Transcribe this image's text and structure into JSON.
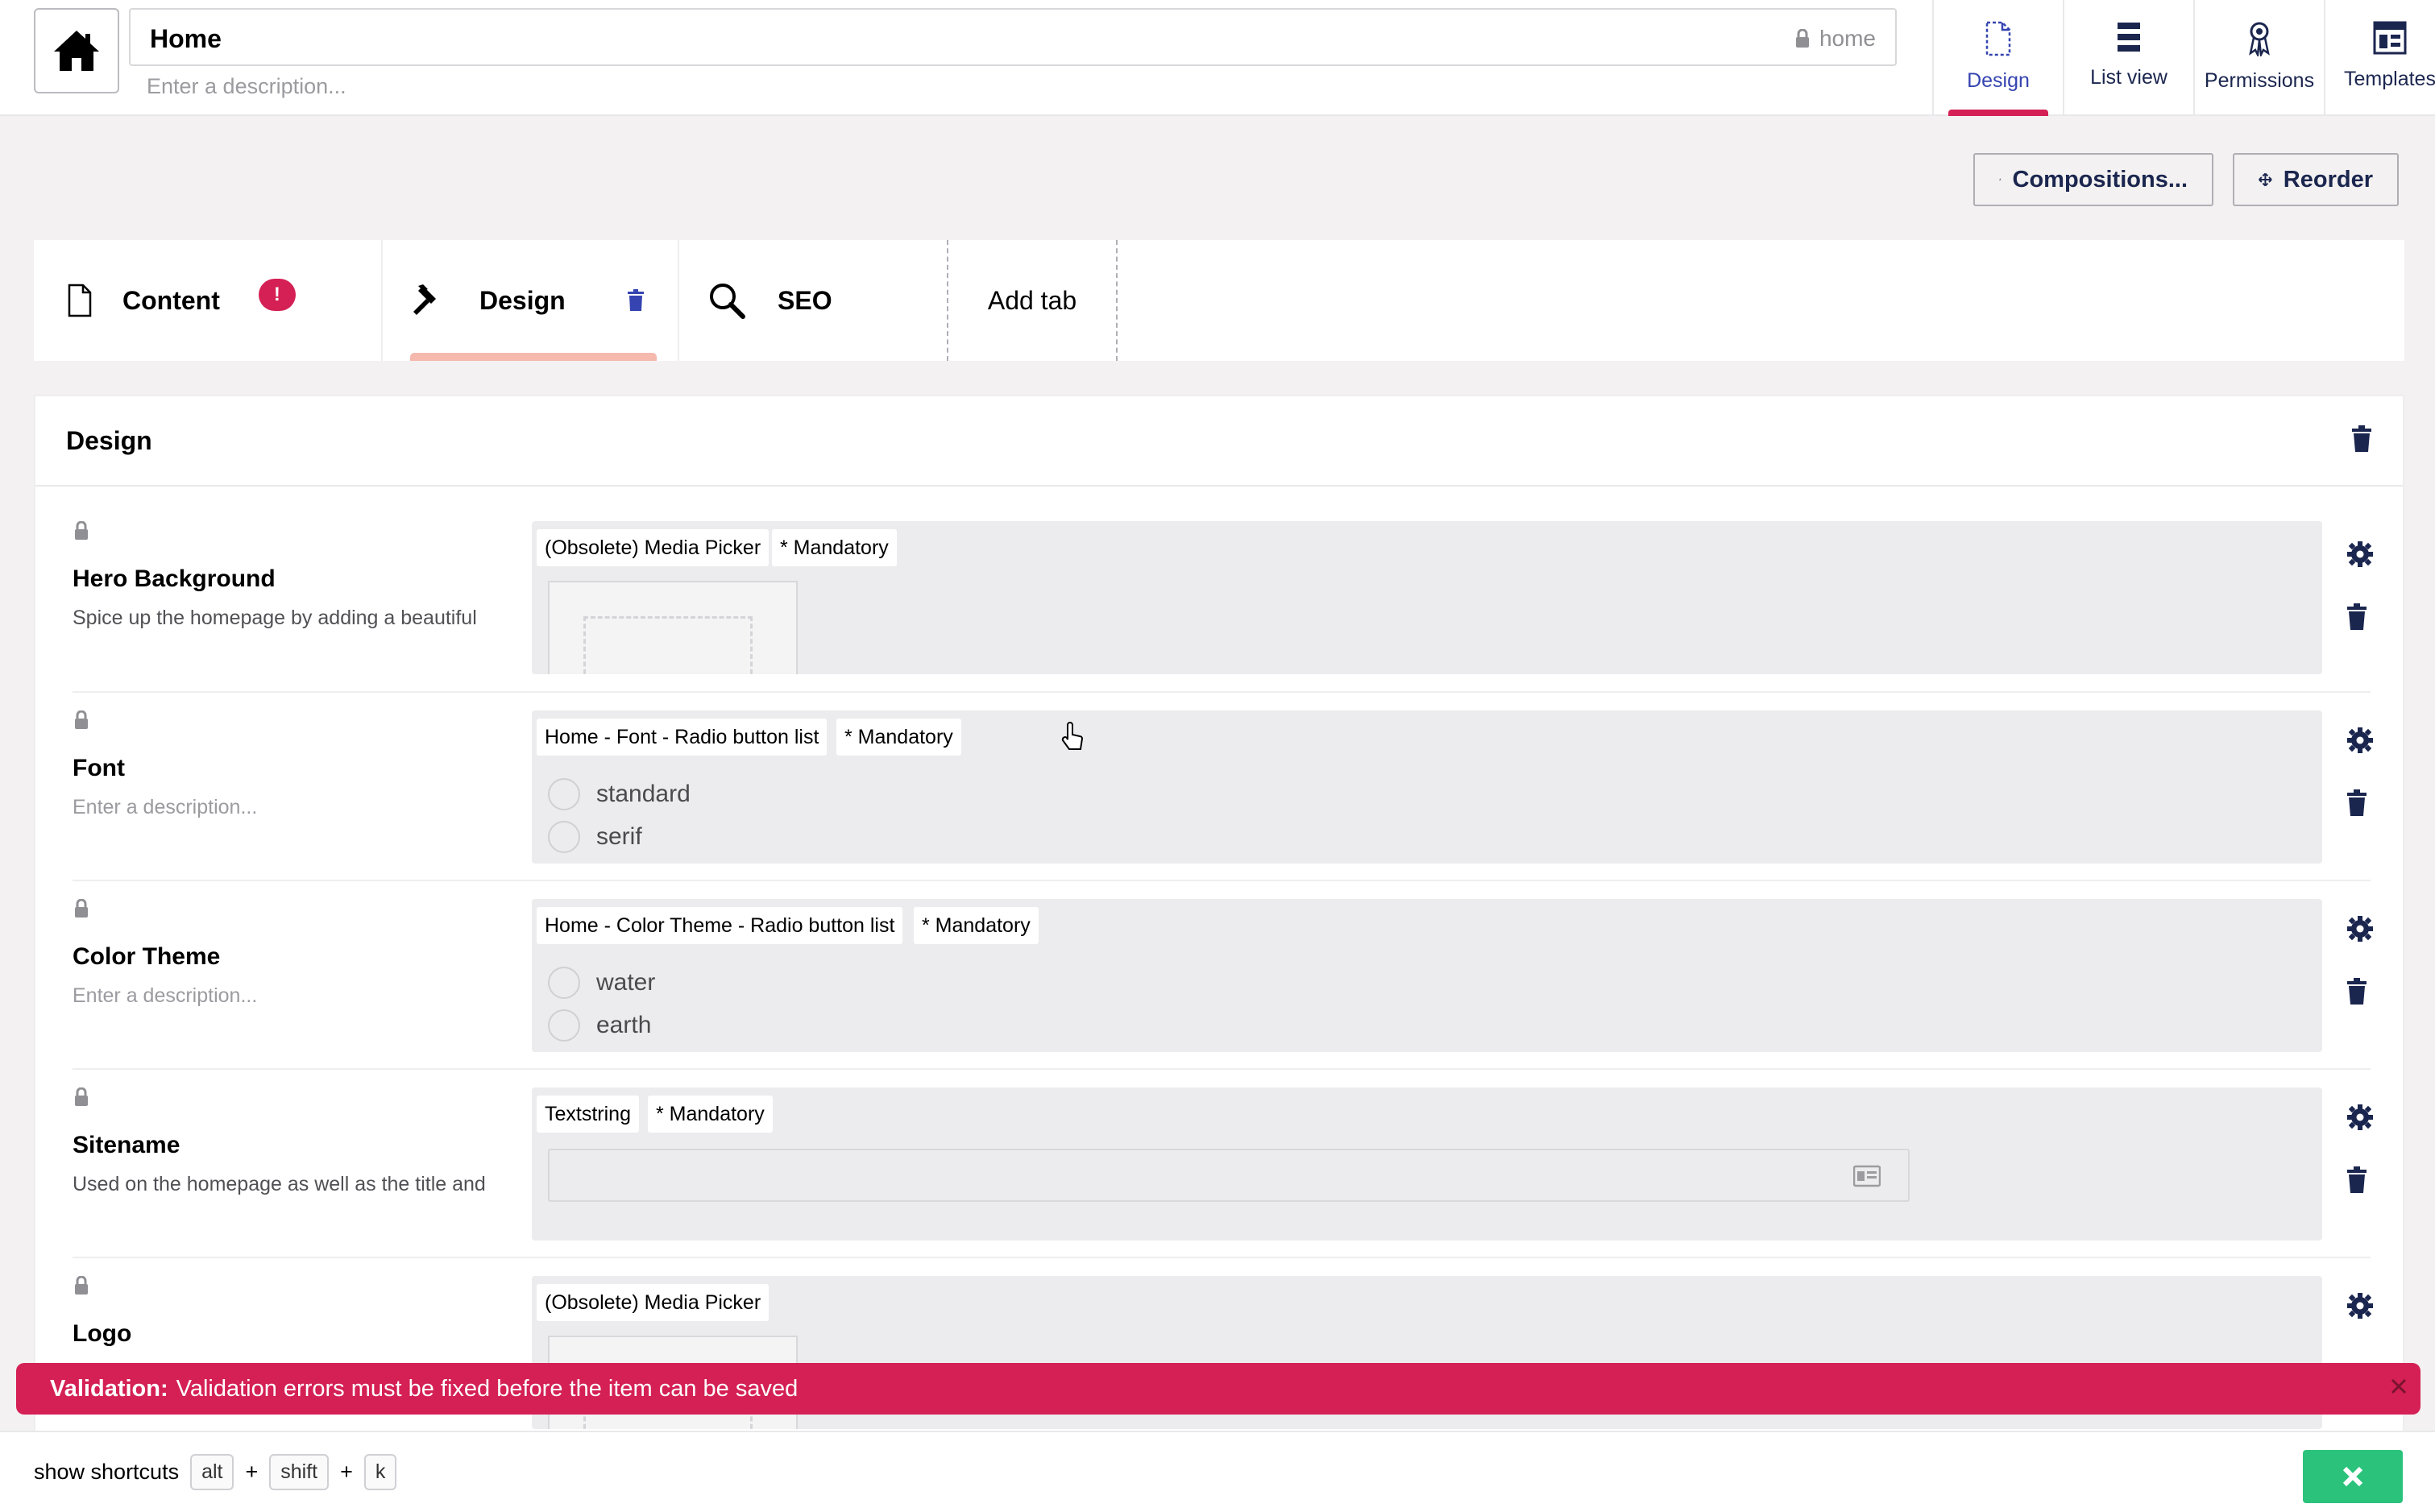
{
  "header": {
    "name": "Home",
    "alias": "home",
    "description_placeholder": "Enter a description..."
  },
  "nav": {
    "items": [
      {
        "label": "Design",
        "icon": "document-icon",
        "active": true
      },
      {
        "label": "List view",
        "icon": "list-icon",
        "active": false
      },
      {
        "label": "Permissions",
        "icon": "permissions-icon",
        "active": false
      },
      {
        "label": "Templates",
        "icon": "layout-icon",
        "active": false
      }
    ]
  },
  "actions": {
    "compositions": "Compositions...",
    "reorder": "Reorder"
  },
  "tabs": {
    "items": [
      {
        "label": "Content",
        "badge": "!"
      },
      {
        "label": "Design"
      },
      {
        "label": "SEO"
      }
    ],
    "add_tab": "Add tab"
  },
  "group": {
    "title": "Design",
    "properties": [
      {
        "name": "Hero Background",
        "description": "Spice up the homepage by adding a beautiful",
        "editor": "(Obsolete) Media Picker",
        "mandatory": "* Mandatory"
      },
      {
        "name": "Font",
        "description": "Enter a description...",
        "editor": "Home - Font - Radio button list",
        "mandatory": "* Mandatory",
        "options": [
          "standard",
          "serif"
        ]
      },
      {
        "name": "Color Theme",
        "description": "Enter a description...",
        "editor": "Home - Color Theme - Radio button list",
        "mandatory": "* Mandatory",
        "options": [
          "water",
          "earth"
        ]
      },
      {
        "name": "Sitename",
        "description": "Used on the homepage as well as the title and",
        "editor": "Textstring",
        "mandatory": "* Mandatory"
      },
      {
        "name": "Logo",
        "description": "",
        "editor": "(Obsolete) Media Picker"
      }
    ]
  },
  "alert": {
    "title": "Validation:",
    "message": "Validation errors must be fixed before the item can be saved"
  },
  "footer": {
    "shortcuts_label": "show shortcuts",
    "keys": [
      "alt",
      "+",
      "shift",
      "+",
      "k"
    ]
  },
  "colors": {
    "accent": "#d42054",
    "navy": "#1b264f",
    "success": "#2bc37c",
    "tab_underline": "#f5b9ad"
  }
}
